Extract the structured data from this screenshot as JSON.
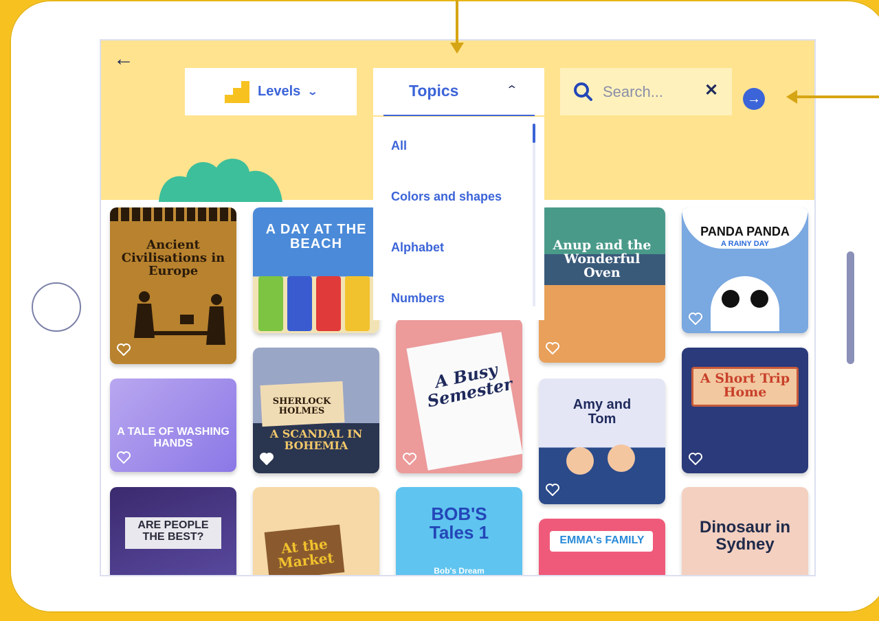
{
  "header": {
    "back_icon": "arrow-left-icon",
    "levels_label": "Levels",
    "topics_label": "Topics",
    "search_placeholder": "Search...",
    "search_value": ""
  },
  "topics_menu": [
    "All",
    "Colors and shapes",
    "Alphabet",
    "Numbers"
  ],
  "books": [
    {
      "title": "Ancient Civilisations in Europe"
    },
    {
      "title": "A DAY AT THE BEACH"
    },
    {
      "title": "Anup and the Wonderful Oven"
    },
    {
      "title": "PANDA PANDA",
      "subtitle": "A RAINY DAY"
    },
    {
      "title": "A TALE OF WASHING HANDS"
    },
    {
      "title": "SHERLOCK HOLMES",
      "subtitle": "A SCANDAL IN BOHEMIA"
    },
    {
      "title": "A Busy Semester"
    },
    {
      "title": "Amy and Tom"
    },
    {
      "title": "A Short Trip Home"
    },
    {
      "title": "ARE PEOPLE THE BEST?"
    },
    {
      "title": "At the Market"
    },
    {
      "title": "BOB'S Tales 1",
      "subtitle": "Bob's Dream"
    },
    {
      "title": "EMMA's FAMILY"
    },
    {
      "title": "Dinosaur in Sydney"
    }
  ],
  "colors": {
    "accent": "#3b64d8",
    "header_bg": "#ffe38e",
    "frame": "#f7c220"
  }
}
